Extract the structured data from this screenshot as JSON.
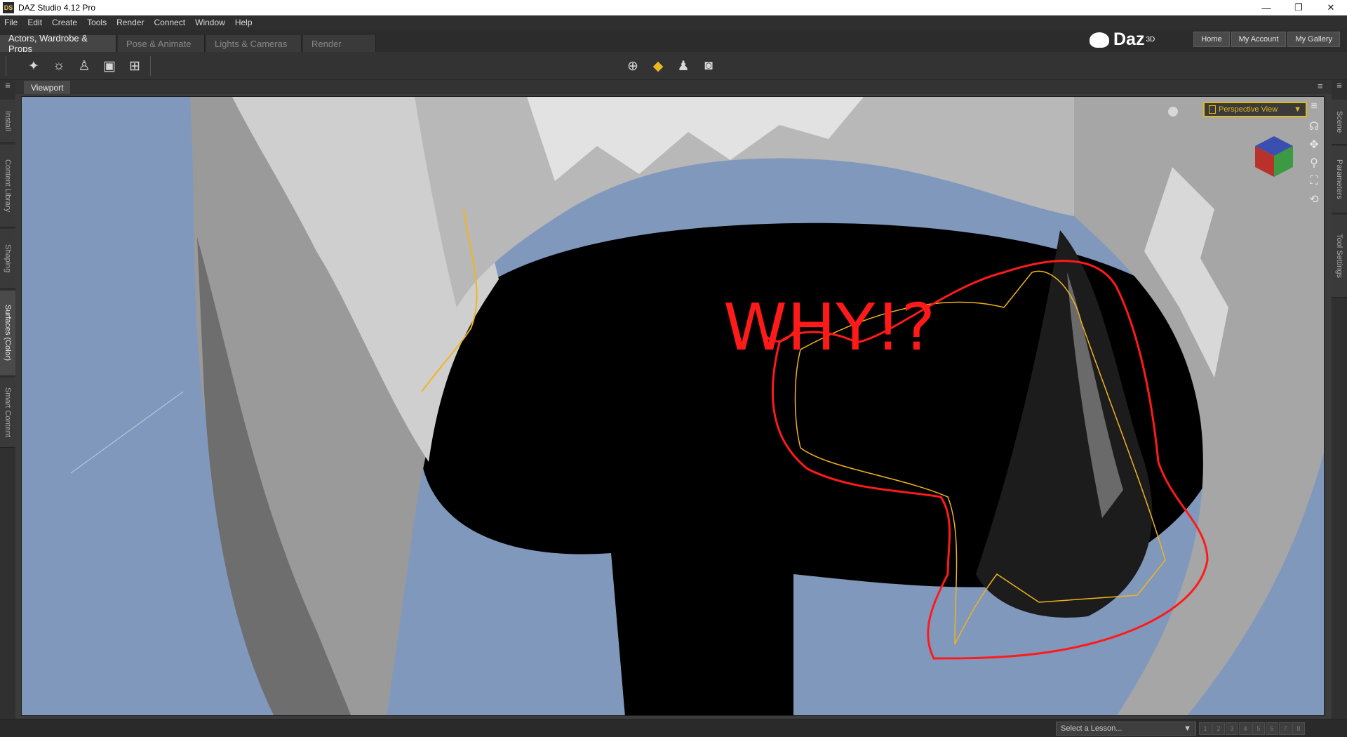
{
  "window": {
    "title": "DAZ Studio 4.12 Pro",
    "app_icon": "DS",
    "controls": [
      "—",
      "❐",
      "✕"
    ]
  },
  "menu": [
    "File",
    "Edit",
    "Create",
    "Tools",
    "Render",
    "Connect",
    "Window",
    "Help"
  ],
  "pane_tabs": [
    "Actors, Wardrobe & Props",
    "Pose & Animate",
    "Lights & Cameras",
    "Render"
  ],
  "brand": {
    "name": "Daz",
    "sup": "3D"
  },
  "nav_buttons": [
    "Home",
    "My Account",
    "My Gallery"
  ],
  "left_tabs": [
    "Install",
    "Content Library",
    "Shaping",
    "Surfaces (Color)",
    "Smart Content"
  ],
  "right_tabs": [
    "Scene",
    "Parameters",
    "Tool Settings"
  ],
  "viewport": {
    "tab": "Viewport",
    "view": "Perspective View",
    "annotation": "WHY!?"
  },
  "status": {
    "lesson_placeholder": "Select a Lesson...",
    "steps": [
      "1",
      "2",
      "3",
      "4",
      "5",
      "6",
      "7",
      "8"
    ]
  },
  "colors": {
    "accent": "#e2b91c",
    "annotation": "#ff1a1a",
    "background": "#8198bd",
    "selection": "#f0b41e"
  }
}
